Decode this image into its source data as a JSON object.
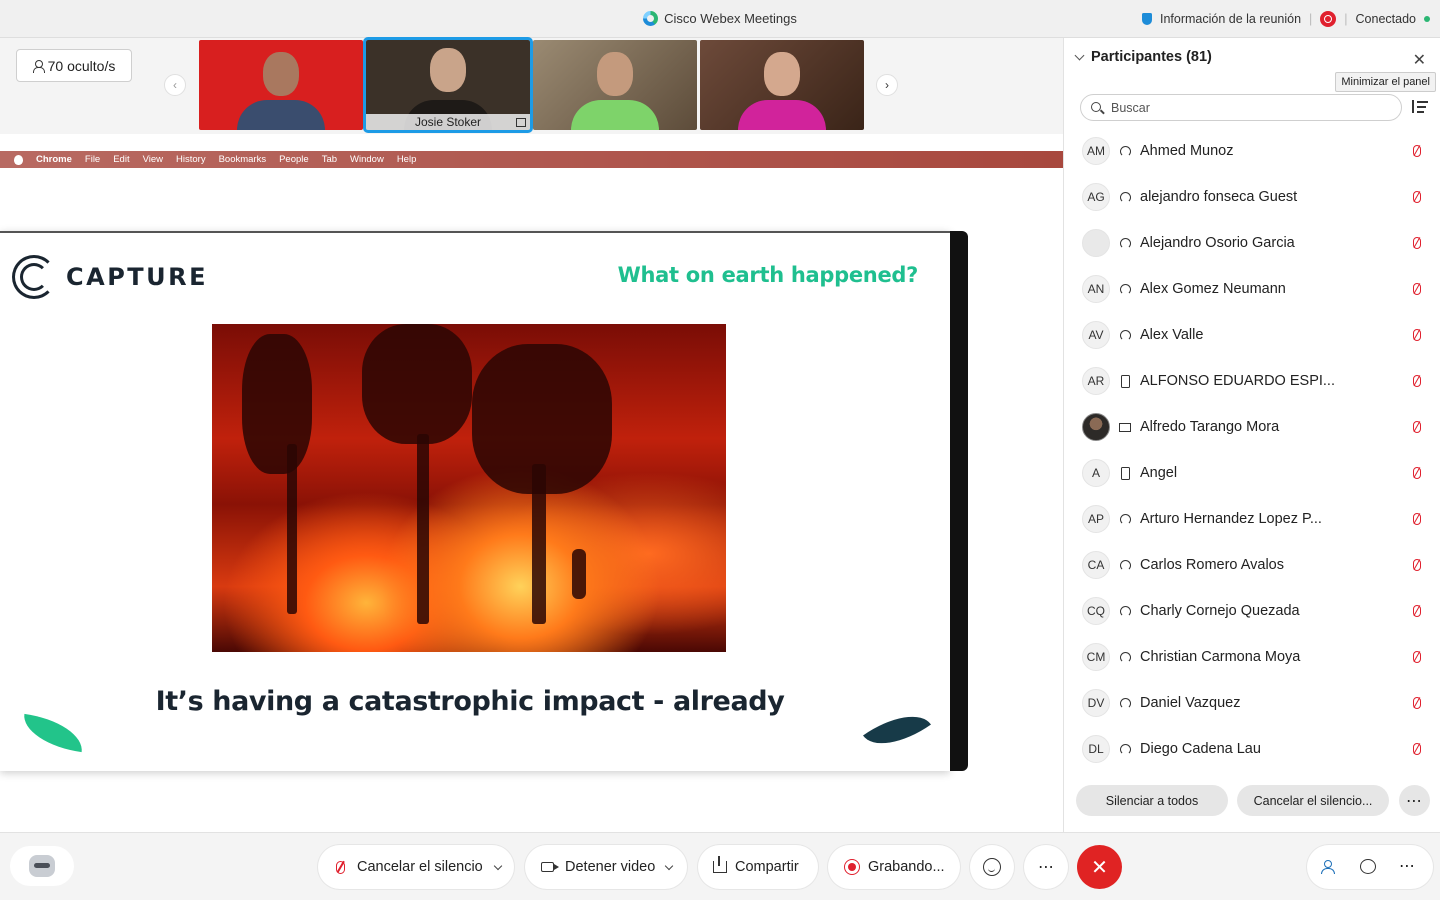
{
  "titlebar": {
    "app_title": "Cisco Webex Meetings",
    "meeting_info": "Información de la reunión",
    "status": "Conectado",
    "accent_green": "#2bb673",
    "record_red": "#e0202e"
  },
  "strip": {
    "hidden_label": "70 oculto/s",
    "tiles": [
      {
        "name": "",
        "bg": "#d81f1f"
      },
      {
        "name": "Josie Stoker",
        "bg": "#3b3128"
      },
      {
        "name": "",
        "bg": "#7a6a55"
      },
      {
        "name": "",
        "bg": "#5a3a2a"
      }
    ]
  },
  "shared": {
    "menubar": [
      "Chrome",
      "File",
      "Edit",
      "View",
      "History",
      "Bookmarks",
      "People",
      "Tab",
      "Window",
      "Help"
    ],
    "brand": "CAPTURE",
    "question": "What on earth happened?",
    "caption": "It’s having a catastrophic impact - already"
  },
  "panel": {
    "title": "Participantes (81)",
    "tooltip": "Minimizar el panel",
    "search_placeholder": "Buscar",
    "participants": [
      {
        "initials": "AM",
        "name": "Ahmed Munoz",
        "device": "headset"
      },
      {
        "initials": "AG",
        "name": "alejandro fonseca Guest",
        "device": "headset"
      },
      {
        "initials": "",
        "name": "Alejandro Osorio Garcia",
        "device": "headset",
        "avatar": "blank"
      },
      {
        "initials": "AN",
        "name": "Alex Gomez Neumann",
        "device": "headset"
      },
      {
        "initials": "AV",
        "name": "Alex Valle",
        "device": "headset"
      },
      {
        "initials": "AR",
        "name": "ALFONSO EDUARDO ESPI...",
        "device": "phone"
      },
      {
        "initials": "",
        "name": "Alfredo Tarango Mora",
        "device": "monitor",
        "avatar": "photo"
      },
      {
        "initials": "A",
        "name": "Angel",
        "device": "phone"
      },
      {
        "initials": "AP",
        "name": "Arturo Hernandez Lopez P...",
        "device": "headset"
      },
      {
        "initials": "CA",
        "name": "Carlos Romero Avalos",
        "device": "headset"
      },
      {
        "initials": "CQ",
        "name": "Charly Cornejo Quezada",
        "device": "headset"
      },
      {
        "initials": "CM",
        "name": "Christian Carmona Moya",
        "device": "headset"
      },
      {
        "initials": "DV",
        "name": "Daniel Vazquez",
        "device": "headset"
      },
      {
        "initials": "DL",
        "name": "Diego Cadena Lau",
        "device": "headset"
      }
    ],
    "mute_all": "Silenciar a todos",
    "unmute_all": "Cancelar el silencio..."
  },
  "controls": {
    "unmute": "Cancelar el silencio",
    "stop_video": "Detener video",
    "share": "Compartir",
    "recording": "Grabando...",
    "more": "⋯",
    "end": "✕"
  }
}
